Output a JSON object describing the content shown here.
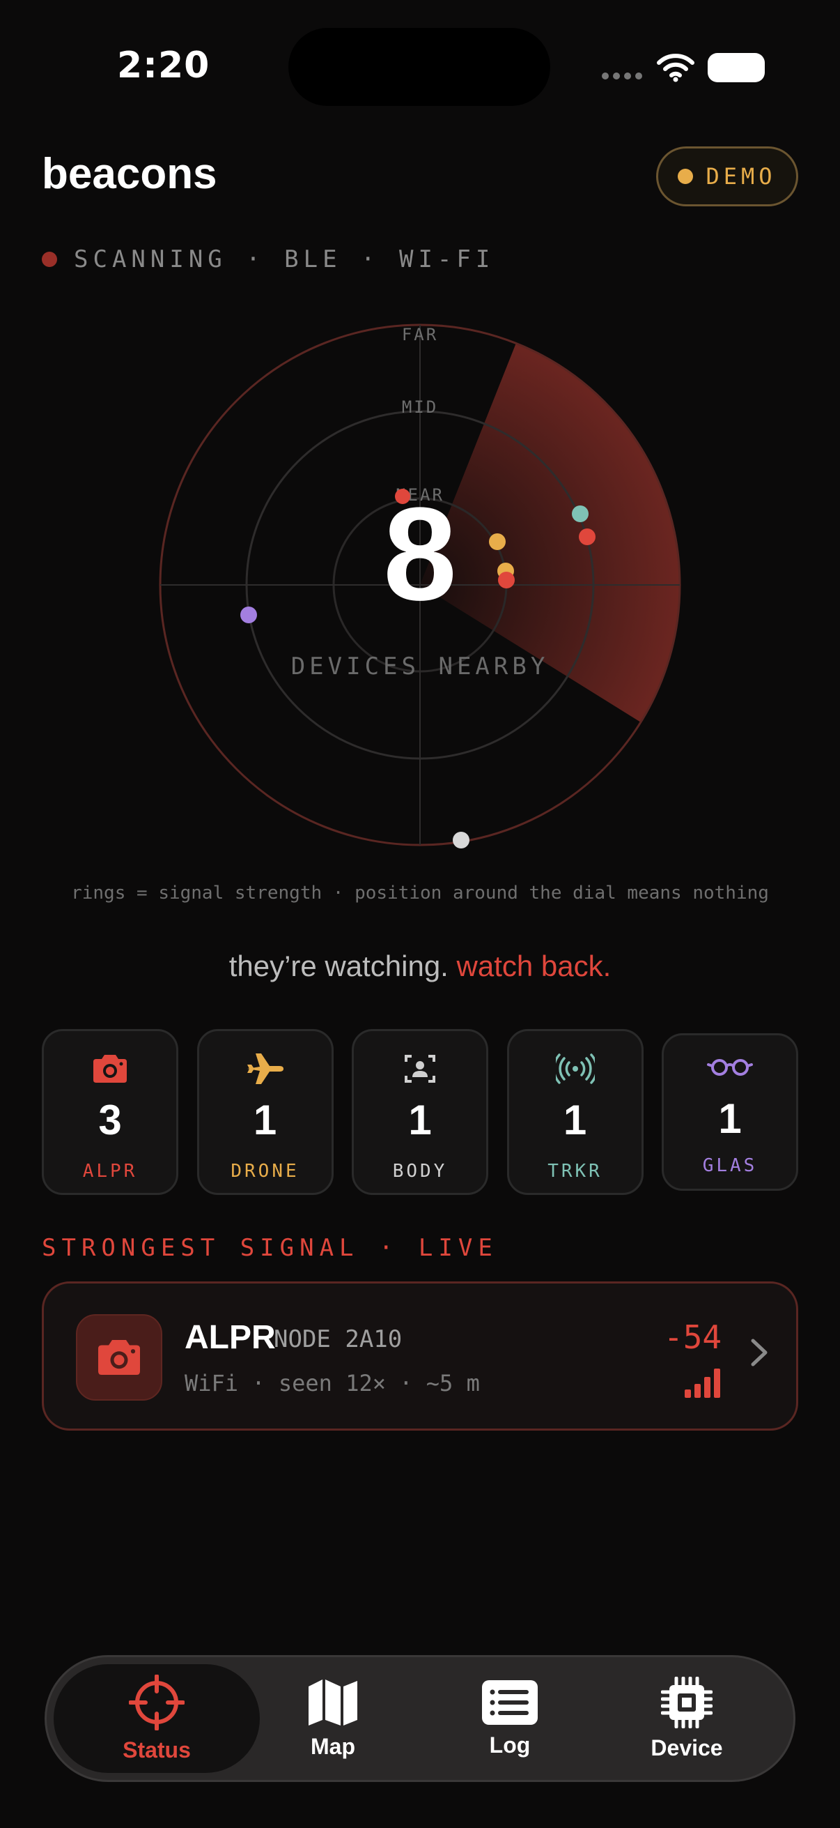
{
  "status_bar": {
    "time": "2:20"
  },
  "header": {
    "title": "beacons",
    "demo_label": "DEMO"
  },
  "scan": {
    "label": "SCANNING · BLE · WI-FI"
  },
  "radar": {
    "ring_labels": {
      "far": "FAR",
      "mid": "MID",
      "near": "NEAR"
    },
    "count": "8",
    "count_label": "DEVICES NEARBY",
    "caption": "rings = signal strength · position around the dial means nothing"
  },
  "tagline": {
    "part1": "they’re watching.",
    "part2": "watch back."
  },
  "categories": [
    {
      "icon": "camera-icon",
      "count": "3",
      "label": "ALPR",
      "color": "#e0473c"
    },
    {
      "icon": "airplane-icon",
      "count": "1",
      "label": "DRONE",
      "color": "#e8ad4a"
    },
    {
      "icon": "body-camera-icon",
      "count": "1",
      "label": "BODY",
      "color": "#d0d0d0"
    },
    {
      "icon": "broadcast-icon",
      "count": "1",
      "label": "TRKR",
      "color": "#7fc2b5"
    },
    {
      "icon": "glasses-icon",
      "count": "1",
      "label": "GLAS",
      "color": "#a37fe0"
    }
  ],
  "strongest": {
    "section_label": "STRONGEST SIGNAL · LIVE",
    "title": "ALPR",
    "subtitle": "NODE 2A10",
    "detail": "WiFi · seen 12× · ~5 m",
    "rssi": "-54",
    "icon": "camera-icon"
  },
  "tabs": [
    {
      "label": "Status",
      "icon": "crosshair-icon",
      "active": true
    },
    {
      "label": "Map",
      "icon": "map-icon",
      "active": false
    },
    {
      "label": "Log",
      "icon": "list-icon",
      "active": false
    },
    {
      "label": "Device",
      "icon": "chip-icon",
      "active": false
    }
  ],
  "colors": {
    "accent": "#e0473c",
    "demo": "#e8ad4a",
    "background": "#0b0a0a"
  }
}
